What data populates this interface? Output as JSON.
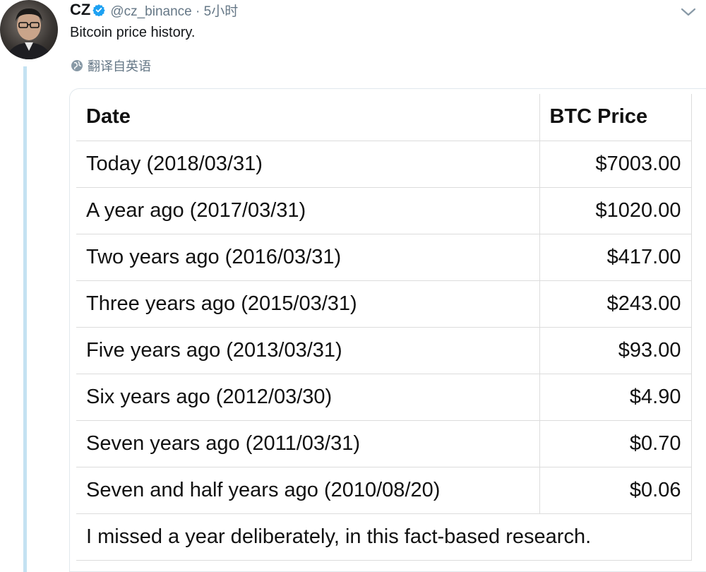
{
  "tweet": {
    "author_name": "CZ",
    "handle_time": "@cz_binance · 5小时",
    "text": "Bitcoin price history.",
    "translate_label": "翻译自英语",
    "verified_color": "#1da1f2"
  },
  "table": {
    "headers": [
      "Date",
      "BTC Price"
    ],
    "rows": [
      {
        "date": "Today (2018/03/31)",
        "price": "$7003.00"
      },
      {
        "date": "A year ago (2017/03/31)",
        "price": "$1020.00"
      },
      {
        "date": "Two years ago (2016/03/31)",
        "price": "$417.00"
      },
      {
        "date": "Three years ago (2015/03/31)",
        "price": "$243.00"
      },
      {
        "date": "Five years ago (2013/03/31)",
        "price": "$93.00"
      },
      {
        "date": "Six years ago (2012/03/30)",
        "price": "$4.90"
      },
      {
        "date": "Seven years ago (2011/03/31)",
        "price": "$0.70"
      },
      {
        "date": "Seven and half years ago (2010/08/20)",
        "price": "$0.06"
      }
    ],
    "note": "I missed a year deliberately, in this fact-based research."
  },
  "icons": {
    "avatar": "avatar-photo",
    "verified": "verified-badge-icon",
    "caret": "chevron-down-icon",
    "translate": "globe-icon"
  },
  "colors": {
    "thread_line": "#c4e2f2",
    "secondary_text": "#657786"
  }
}
